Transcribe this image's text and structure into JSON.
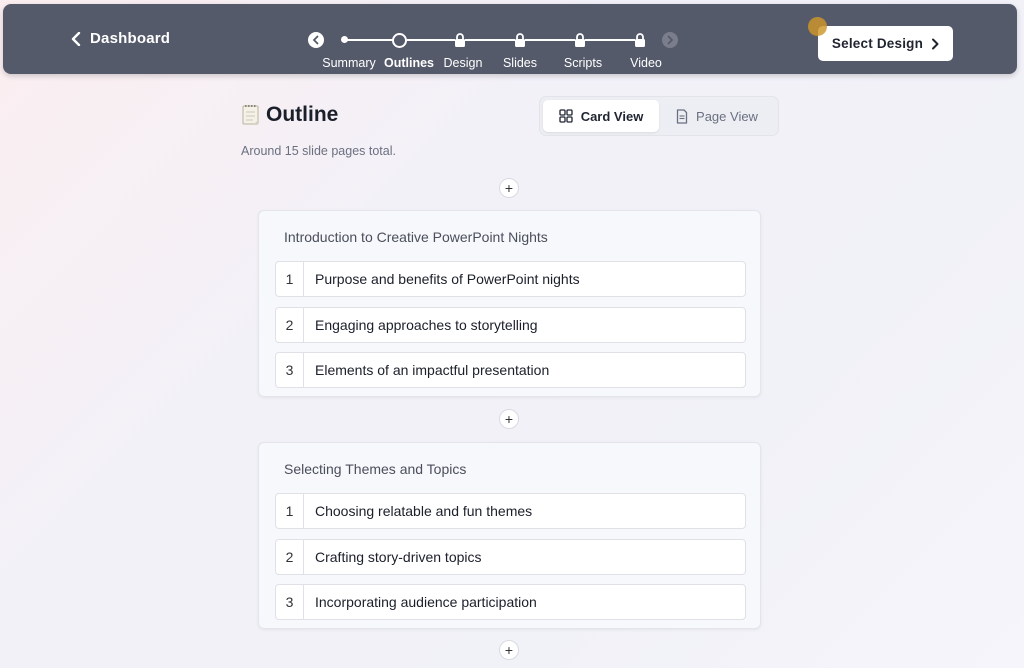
{
  "header": {
    "back_label": "Dashboard",
    "steps": [
      {
        "label": "Summary",
        "state": "done"
      },
      {
        "label": "Outlines",
        "state": "current"
      },
      {
        "label": "Design",
        "state": "locked"
      },
      {
        "label": "Slides",
        "state": "locked"
      },
      {
        "label": "Scripts",
        "state": "locked"
      },
      {
        "label": "Video",
        "state": "locked"
      }
    ],
    "select_design_label": "Select Design"
  },
  "outline": {
    "title": "Outline",
    "subtitle": "Around 15 slide pages total.",
    "views": [
      {
        "label": "Card View",
        "icon": "grid-icon",
        "active": true
      },
      {
        "label": "Page View",
        "icon": "page-icon",
        "active": false
      }
    ],
    "add_symbol": "+",
    "sections": [
      {
        "title": "Introduction to Creative PowerPoint Nights",
        "items": [
          {
            "num": "1",
            "text": "Purpose and benefits of PowerPoint nights"
          },
          {
            "num": "2",
            "text": "Engaging approaches to storytelling"
          },
          {
            "num": "3",
            "text": "Elements of an impactful presentation"
          }
        ]
      },
      {
        "title": "Selecting Themes and Topics",
        "items": [
          {
            "num": "1",
            "text": "Choosing relatable and fun themes"
          },
          {
            "num": "2",
            "text": "Crafting story-driven topics"
          },
          {
            "num": "3",
            "text": "Incorporating audience participation"
          }
        ]
      }
    ]
  },
  "colors": {
    "topbar": "#555a6b",
    "accent_dot": "#ce9628"
  }
}
